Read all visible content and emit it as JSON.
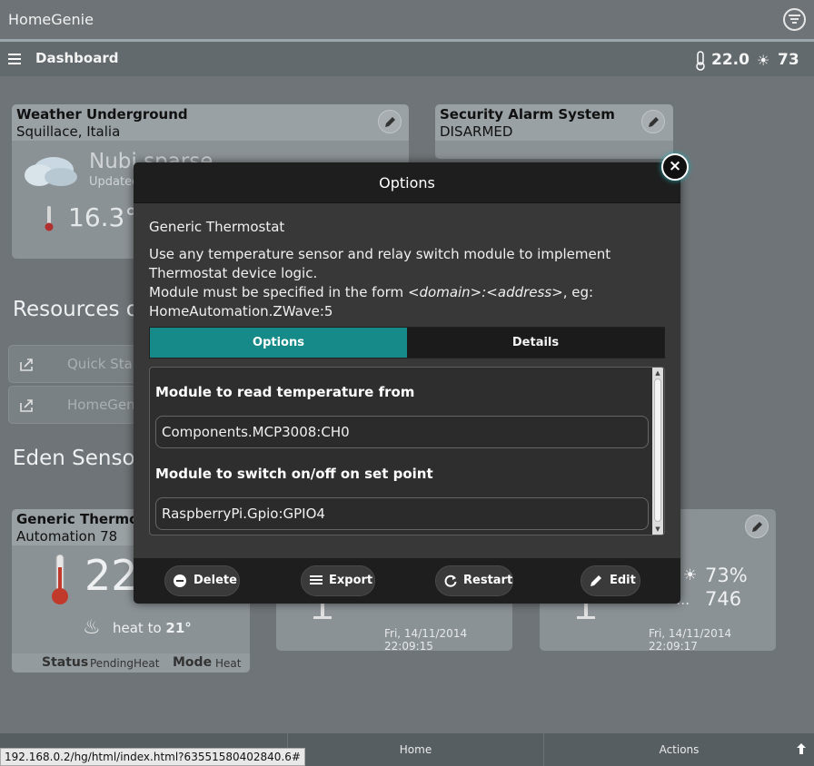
{
  "app": {
    "title": "HomeGenie"
  },
  "navbar": {
    "title": "Dashboard",
    "temperature": "22.0",
    "luminance": "73"
  },
  "dashboard": {
    "weather": {
      "title": "Weather Underground",
      "location": "Squillace, Italia",
      "condition": "Nubi sparse",
      "updated": "Updated",
      "temperature": "16.3°C"
    },
    "security": {
      "title": "Security Alarm System",
      "status": "DISARMED"
    },
    "resources_title": "Resources o",
    "links": [
      {
        "label": "Quick Start"
      },
      {
        "label": "HomeGenie"
      }
    ],
    "group_title": "Eden Sensor",
    "thermostat": {
      "title": "Generic Thermos",
      "subtitle": "Automation 78",
      "temp": "22",
      "heat_text": "heat to ",
      "heat_value": "21°",
      "status_label": "Status",
      "status_value": "PendingHeat",
      "mode_label": "Mode",
      "mode_value": "Heat"
    },
    "sensor1": {
      "timestamp": "Fri, 14/11/2014 22:09:15"
    },
    "sensor2": {
      "humidity": "73%",
      "value": "746",
      "trunc": "...",
      "timestamp": "Fri, 14/11/2014 22:09:17"
    }
  },
  "modal": {
    "title": "Options",
    "close": "×",
    "program_name": "Generic Thermostat",
    "description_1": "Use any temperature sensor and relay switch module to implement Thermostat device logic.",
    "description_2a": "Module must be specified in the form ",
    "description_2b": "<domain>:<address>",
    "description_2c": ", eg: HomeAutomation.ZWave:5",
    "tabs": [
      {
        "label": "Options"
      },
      {
        "label": "Details"
      }
    ],
    "fields": [
      {
        "label": "Module to read temperature from",
        "value": "Components.MCP3008:CH0"
      },
      {
        "label": "Module to switch on/off on set point",
        "value": "RaspberryPi.Gpio:GPIO4"
      }
    ],
    "buttons": {
      "delete": "Delete",
      "export": "Export",
      "restart": "Restart",
      "edit": "Edit"
    }
  },
  "bottom": {
    "home": "Home",
    "actions": "Actions"
  },
  "status_url": "192.168.0.2/hg/html/index.html?63551580402840.6#",
  "colors": {
    "accent": "#168a88",
    "background": "#6e7477",
    "modal": "#383838"
  }
}
